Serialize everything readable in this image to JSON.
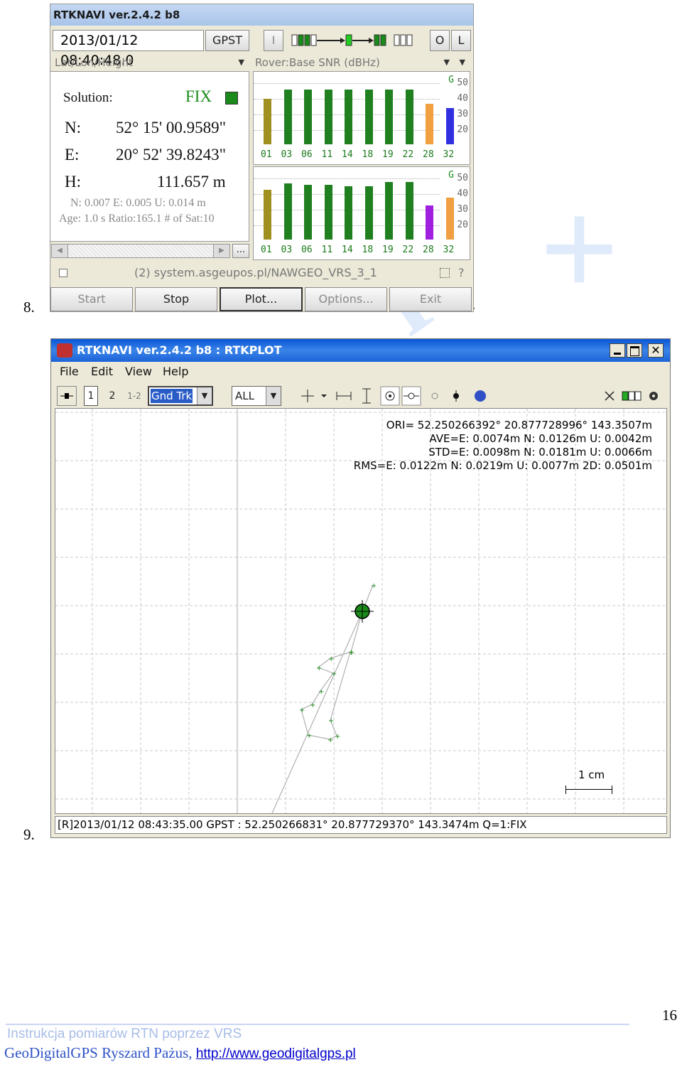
{
  "doc": {
    "item8": "8.",
    "item8_dot": ".",
    "item9": "9.",
    "page_number": "16",
    "footer_line1": "Instrukcja pomiarów RTN poprzez VRS",
    "footer_line2": "GeoDigitalGPS Ryszard Pażus,",
    "footer_link": "http://www.geodigitalgps.pl"
  },
  "navi": {
    "title": "RTKNAVI ver.2.4.2 b8",
    "time": "2013/01/12 08:40:48.0",
    "time_sys": "GPST",
    "btn_i": "I",
    "btn_o": "O",
    "btn_l": "L",
    "left_select": "Lat/Lon/Height",
    "right_select": "Rover:Base SNR (dBHz)",
    "solution_label": "Solution:",
    "solution_value": "FIX",
    "n_label": "N:",
    "n_value": "52° 15' 00.9589\"",
    "e_label": "E:",
    "e_value": "20° 52' 39.8243\"",
    "h_label": "H:",
    "h_value": "111.657 m",
    "std_line": "N: 0.007 E: 0.005 U: 0.014 m",
    "age_line": "Age: 1.0 s Ratio:165.1 # of Sat:10",
    "scroll_more": "...",
    "stream": "(2) system.asgeupos.pl/NAWGEO_VRS_3_1",
    "stream_help": "?",
    "buttons": [
      "Start",
      "Stop",
      "Plot...",
      "Options...",
      "Exit"
    ]
  },
  "snr": {
    "system_letter": "G",
    "scale": [
      "50",
      "40",
      "30",
      "20"
    ],
    "sats": [
      "01",
      "03",
      "06",
      "11",
      "14",
      "18",
      "19",
      "22",
      "28",
      "32"
    ],
    "rover": [
      39,
      45,
      45,
      45,
      45,
      45,
      45,
      45,
      36,
      33
    ],
    "base": [
      42,
      46,
      45,
      45,
      44,
      44,
      47,
      47,
      32,
      37
    ],
    "rover_colors": [
      "#a09020",
      "#208020",
      "#208020",
      "#208020",
      "#208020",
      "#208020",
      "#208020",
      "#208020",
      "#f0a040",
      "#3030e0"
    ],
    "base_colors": [
      "#a09020",
      "#208020",
      "#208020",
      "#208020",
      "#208020",
      "#208020",
      "#208020",
      "#208020",
      "#a020e0",
      "#f0a040"
    ]
  },
  "plot": {
    "title": "RTKNAVI ver.2.4.2 b8 : RTKPLOT",
    "menu": [
      "File",
      "Edit",
      "View",
      "Help"
    ],
    "tb_1": "1",
    "tb_2": "2",
    "tb_12": "1-2",
    "plot_type": "Gnd Trk",
    "sat_select": "ALL",
    "ori": "ORI= 52.250266392°   20.877728996° 143.3507m",
    "ave": "AVE=E: 0.0074m N: 0.0126m U: 0.0042m",
    "std": "STD=E: 0.0098m N: 0.0181m U: 0.0066m",
    "rms": "RMS=E: 0.0122m N: 0.0219m U: 0.0077m 2D: 0.0501m",
    "scale_label": "1 cm",
    "status": "[R]2013/01/12 08:43:35.00 GPST :  52.250266831°   20.877729370°  143.3474m  Q=",
    "status_q": "1:FIX"
  }
}
